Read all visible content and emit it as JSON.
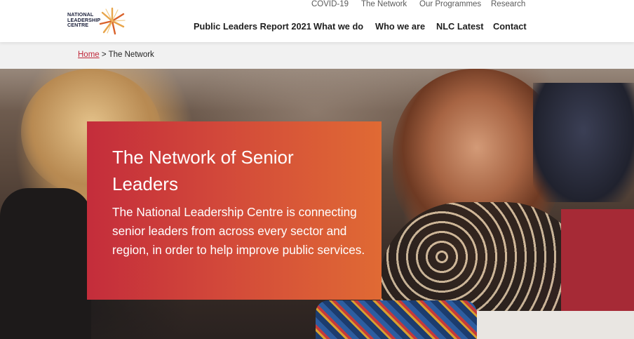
{
  "logo": {
    "line1": "NATIONAL",
    "line2": "LEADERSHIP",
    "line3": "CENTRE"
  },
  "nav_top": [
    "COVID-19",
    "The Network",
    "Our Programmes",
    "Research"
  ],
  "nav_main": [
    "Public Leaders Report 2021",
    "What we do",
    "Who we are",
    "NLC Latest",
    "Contact"
  ],
  "breadcrumb": {
    "home": "Home",
    "separator": ">",
    "current": "The Network"
  },
  "hero": {
    "title": "The Network of Senior Leaders",
    "description": "The National Leadership Centre is connecting senior leaders from across every sector and region, in order to help improve public services."
  },
  "colors": {
    "accent_red": "#c42d3b",
    "accent_orange": "#e06a34",
    "link": "#c0283a"
  }
}
